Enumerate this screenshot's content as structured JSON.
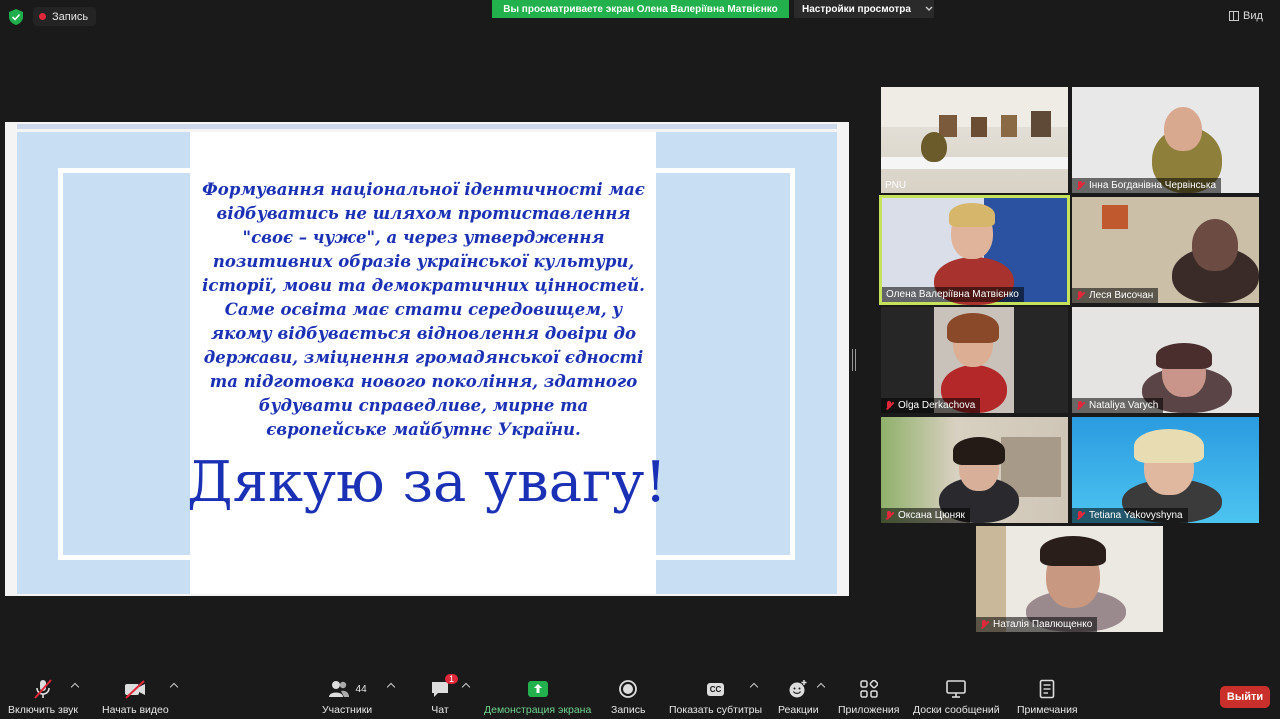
{
  "topbar": {
    "recording_label": "Запись",
    "share_banner": "Вы просматриваете экран Олена Валеріївна Матвієнко",
    "view_options": "Настройки просмотра",
    "view_label": "Вид"
  },
  "slide": {
    "quote": "Формування національної ідентичності має відбуватись не шляхом протиставлення \"своє – чуже\", а через утвердження позитивних образів української культури, історії, мови та демократичних цінностей. Саме освіта має стати середовищем, у якому відбувається відновлення довіри до держави, зміцнення громадянської єдності та підготовка нового покоління, здатного будувати справедливе, мирне та європейське майбутнє України.",
    "thanks": "Дякую за увагу!"
  },
  "participants": [
    {
      "name": "PNU",
      "muted": false
    },
    {
      "name": "Інна Богданівна Червінська",
      "muted": true
    },
    {
      "name": "Олена Валеріївна Матвієнко",
      "muted": false,
      "active": true
    },
    {
      "name": "Леся Височан",
      "muted": true
    },
    {
      "name": "Olga Derkachova",
      "muted": true
    },
    {
      "name": "Nataliya Varych",
      "muted": true
    },
    {
      "name": "Оксана Цюняк",
      "muted": true
    },
    {
      "name": "Tetiana Yakovyshyna",
      "muted": true
    },
    {
      "name": "Наталія Павлющенко",
      "muted": true
    }
  ],
  "toolbar": {
    "mute": "Включить звук",
    "video": "Начать видео",
    "participants": "Участники",
    "participants_count": "44",
    "chat": "Чат",
    "chat_badge": "1",
    "share": "Демонстрация экрана",
    "record": "Запись",
    "captions": "Показать субтитры",
    "captions_icon": "CC",
    "reactions": "Реакции",
    "apps": "Приложения",
    "whiteboards": "Доски сообщений",
    "notes": "Примечания",
    "exit": "Выйти"
  },
  "colors": {
    "share_green": "#22b14c",
    "slide_blue_text": "#1b31b5",
    "slide_bg": "#c8def3",
    "active_speaker": "#c6e25a",
    "exit_red": "#c9302c"
  }
}
